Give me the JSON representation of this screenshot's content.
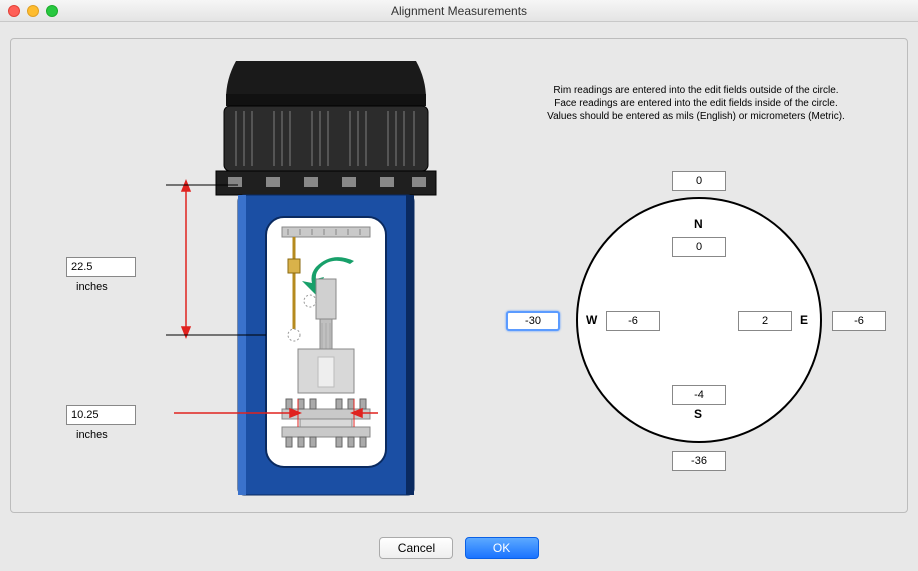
{
  "title": "Alignment Measurements",
  "instructions": {
    "line1": "Rim readings are entered into the edit fields outside of the circle.",
    "line2": "Face readings are entered into the edit fields inside of the circle.",
    "line3": "Values should be entered as mils (English) or micrometers (Metric)."
  },
  "dimensions": {
    "top": {
      "value": "22.5",
      "unit": "inches"
    },
    "bottom": {
      "value": "10.25",
      "unit": "inches"
    }
  },
  "compass": {
    "labels": {
      "n": "N",
      "s": "S",
      "e": "E",
      "w": "W"
    },
    "rim": {
      "n": "0",
      "s": "-36",
      "e": "-6",
      "w": "-30"
    },
    "face": {
      "n": "0",
      "s": "-4",
      "e": "2",
      "w": "-6"
    }
  },
  "buttons": {
    "cancel": "Cancel",
    "ok": "OK"
  }
}
